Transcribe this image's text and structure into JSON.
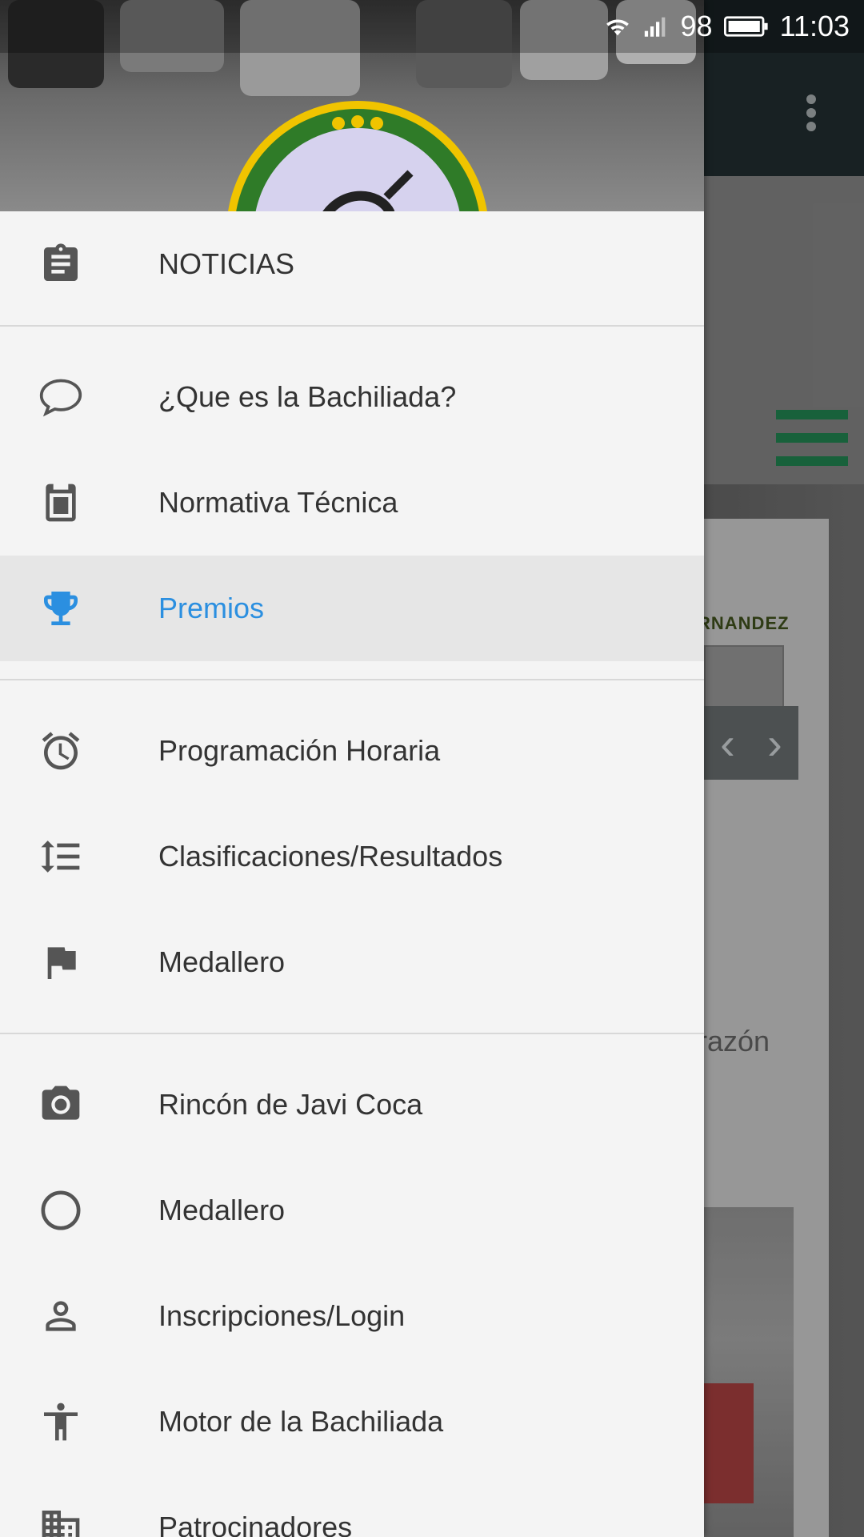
{
  "status_bar": {
    "battery_level": "98",
    "time": "11:03"
  },
  "background": {
    "caption_top": "RNANDEZ",
    "caption_bottom": "razón"
  },
  "drawer": {
    "menu_items": [
      {
        "label": "NOTICIAS",
        "icon": "clipboard-icon"
      },
      {
        "label": "¿Que es la Bachiliada?",
        "icon": "chat-bubble-icon"
      },
      {
        "label": "Normativa Técnica",
        "icon": "book-icon"
      },
      {
        "label": "Premios",
        "icon": "trophy-icon",
        "active": true
      },
      {
        "label": "Programación Horaria",
        "icon": "alarm-clock-icon"
      },
      {
        "label": "Clasificaciones/Resultados",
        "icon": "format-list-icon"
      },
      {
        "label": "Medallero",
        "icon": "flag-icon"
      },
      {
        "label": "Rincón de Javi Coca",
        "icon": "camera-icon"
      },
      {
        "label": "Medallero",
        "icon": "circle-icon"
      },
      {
        "label": "Inscripciones/Login",
        "icon": "person-icon"
      },
      {
        "label": "Motor de la Bachiliada",
        "icon": "accessibility-icon"
      },
      {
        "label": "Patrocinadores",
        "icon": "business-icon"
      }
    ]
  },
  "colors": {
    "active_accent": "#2b8fe0",
    "icon_gray": "#555555",
    "brand_green": "#1f7a4a"
  }
}
